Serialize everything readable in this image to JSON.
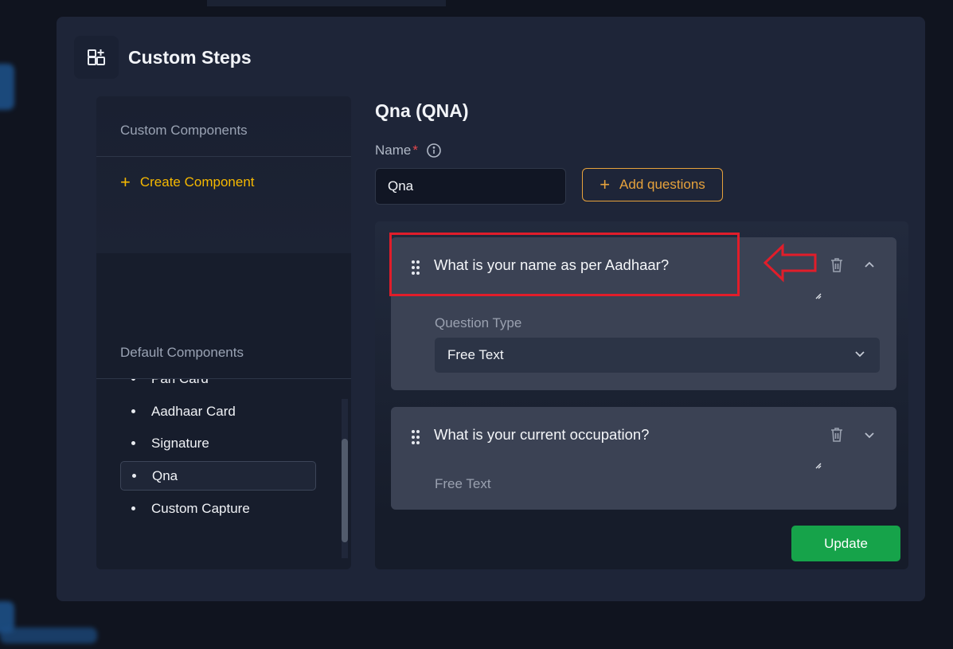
{
  "modal": {
    "title": "Custom Steps",
    "icon": "grid-plus-icon"
  },
  "sidebar": {
    "custom_title": "Custom Components",
    "create_label": "Create Component",
    "default_title": "Default Components",
    "items": [
      {
        "label": "Pan Card"
      },
      {
        "label": "Aadhaar Card"
      },
      {
        "label": "Signature"
      },
      {
        "label": "Qna"
      },
      {
        "label": "Custom Capture"
      }
    ],
    "active_item": "Qna"
  },
  "main": {
    "heading": "Qna (QNA)",
    "name_label": "Name",
    "required_mark": "*",
    "name_value": "Qna",
    "add_questions_label": "Add questions",
    "questions": [
      {
        "text": "What is your name as per Aadhaar?",
        "expanded": true,
        "type_label": "Question Type",
        "type_value": "Free Text"
      },
      {
        "text": "What is your current occupation?",
        "expanded": false,
        "type_value": "Free Text"
      }
    ],
    "update_label": "Update"
  },
  "colors": {
    "accent": "#f5b800",
    "add_button": "#e6a23c",
    "update_button": "#16a34a",
    "annotation": "#e11d2a"
  }
}
